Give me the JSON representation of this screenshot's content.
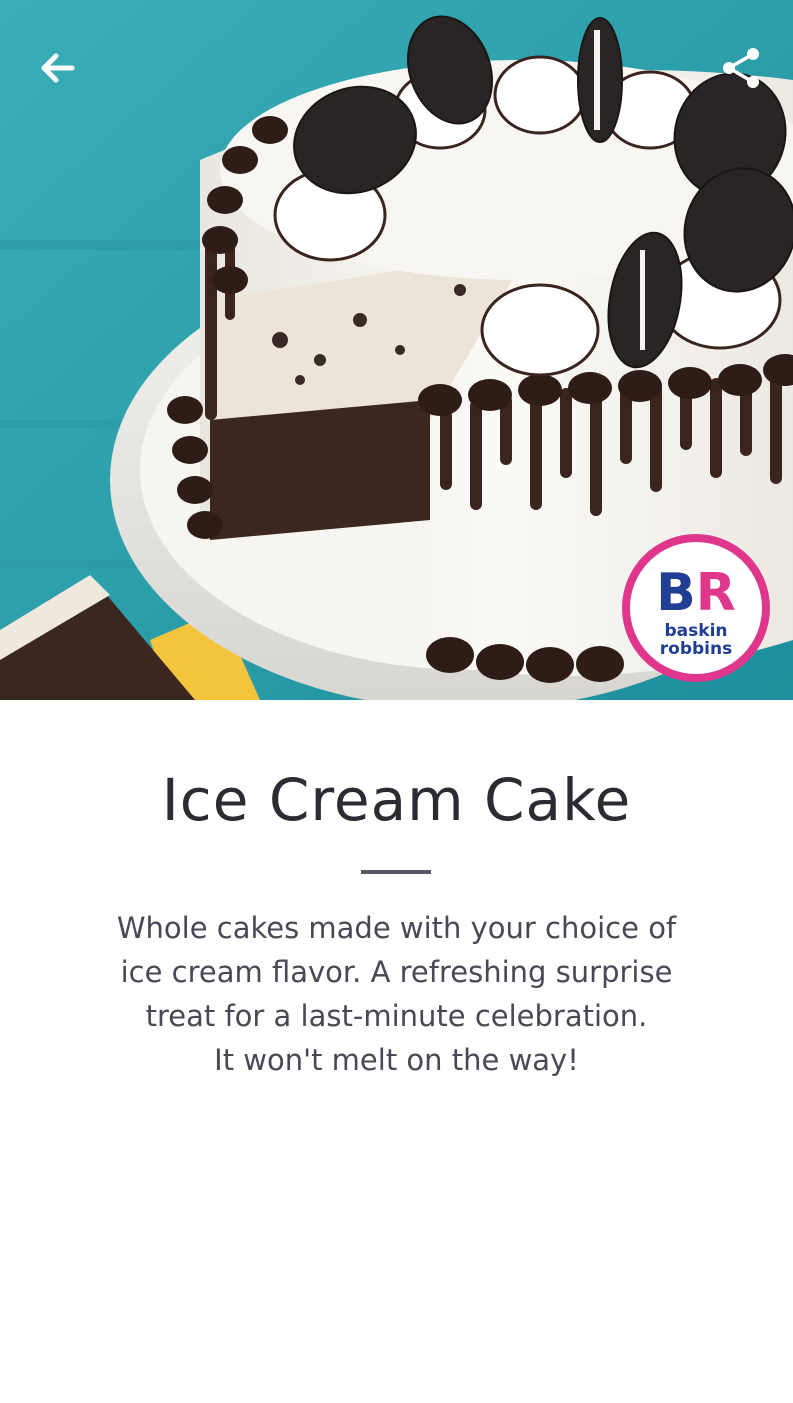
{
  "product": {
    "title": "Ice Cream Cake",
    "description": "Whole cakes made with your choice of\nice cream flavor. A refreshing surprise\ntreat for a last-minute celebration.\nIt won't melt on the way!"
  },
  "header": {
    "back_icon": "arrow-left-icon",
    "share_icon": "share-icon"
  },
  "hero": {
    "image_subject": "ice-cream-cake-photo",
    "brand_logo": {
      "line1": "BR",
      "line2": "baskin",
      "line3": "robbins"
    }
  },
  "colors": {
    "title": "#2c2a33",
    "text": "#4a4856",
    "divider": "#5a5864",
    "logo_blue": "#1f3e94",
    "logo_pink": "#e0368c"
  }
}
